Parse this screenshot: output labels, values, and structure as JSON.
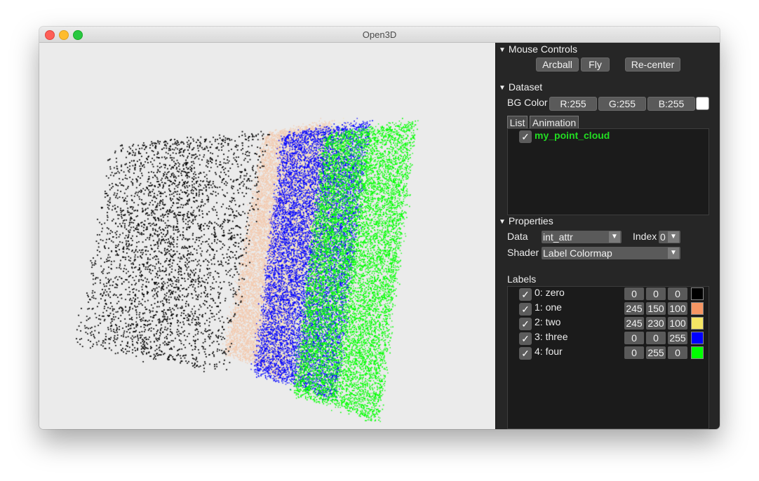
{
  "window": {
    "title": "Open3D"
  },
  "mouse_controls": {
    "header": "Mouse Controls",
    "buttons": [
      "Arcball",
      "Fly",
      "Re-center"
    ]
  },
  "dataset": {
    "header": "Dataset",
    "bg_color_label": "BG Color",
    "bg_r": "R:255",
    "bg_g": "G:255",
    "bg_b": "B:255",
    "bg_swatch": "#ffffff",
    "tabs": [
      "List",
      "Animation"
    ],
    "items": [
      {
        "name": "my_point_cloud",
        "checked": true,
        "color": "#22dd22"
      }
    ]
  },
  "properties": {
    "header": "Properties",
    "data_label": "Data",
    "data_value": "int_attr",
    "index_label": "Index",
    "index_value": "0",
    "shader_label": "Shader",
    "shader_value": "Label Colormap"
  },
  "labels": {
    "header": "Labels",
    "items": [
      {
        "name": "0: zero",
        "r": "0",
        "g": "0",
        "b": "0",
        "color": "#000000"
      },
      {
        "name": "1: one",
        "r": "245",
        "g": "150",
        "b": "100",
        "color": "#f59664"
      },
      {
        "name": "2: two",
        "r": "245",
        "g": "230",
        "b": "100",
        "color": "#f5e664"
      },
      {
        "name": "3: three",
        "r": "0",
        "g": "0",
        "b": "255",
        "color": "#0000ff"
      },
      {
        "name": "4: four",
        "r": "0",
        "g": "255",
        "b": "0",
        "color": "#00ff00"
      }
    ]
  },
  "icons": {
    "collapse": "triangle-down-icon",
    "check": "checkmark-icon",
    "dropdown": "dropdown-arrow-icon"
  }
}
